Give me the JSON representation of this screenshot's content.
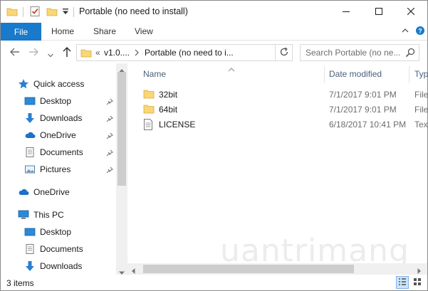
{
  "title_bar": {
    "title": "Portable (no need to install)",
    "qat_icons": [
      "folder-icon",
      "properties-icon",
      "new-folder-icon",
      "customize-qat-icon"
    ],
    "window_controls": [
      "minimize-icon",
      "maximize-icon",
      "close-icon"
    ]
  },
  "ribbon": {
    "tabs": [
      {
        "label": "File"
      },
      {
        "label": "Home"
      },
      {
        "label": "Share"
      },
      {
        "label": "View"
      }
    ],
    "accent": "#1979ca"
  },
  "address_bar": {
    "overflow": "«",
    "crumbs": [
      "v1.0....",
      "Portable (no need to i..."
    ]
  },
  "search": {
    "placeholder": "Search Portable (no ne..."
  },
  "navigation": {
    "quick_access": "Quick access",
    "quick_items": [
      {
        "label": "Desktop",
        "icon": "desktop-icon"
      },
      {
        "label": "Downloads",
        "icon": "downloads-icon"
      },
      {
        "label": "OneDrive",
        "icon": "onedrive-icon"
      },
      {
        "label": "Documents",
        "icon": "documents-icon"
      },
      {
        "label": "Pictures",
        "icon": "pictures-icon"
      }
    ],
    "onedrive": "OneDrive",
    "this_pc": "This PC",
    "pc_items": [
      {
        "label": "Desktop",
        "icon": "desktop-icon"
      },
      {
        "label": "Documents",
        "icon": "documents-icon"
      },
      {
        "label": "Downloads",
        "icon": "downloads-icon"
      }
    ]
  },
  "file_list": {
    "columns": {
      "name": "Name",
      "date": "Date modified",
      "type": "Typ"
    },
    "rows": [
      {
        "name": "32bit",
        "date": "7/1/2017 9:01 PM",
        "type": "File",
        "icon": "folder-icon"
      },
      {
        "name": "64bit",
        "date": "7/1/2017 9:01 PM",
        "type": "File",
        "icon": "folder-icon"
      },
      {
        "name": "LICENSE",
        "date": "6/18/2017 10:41 PM",
        "type": "Text",
        "icon": "text-file-icon"
      }
    ]
  },
  "status_bar": {
    "count": "3 items"
  },
  "watermark": "uantrimang"
}
